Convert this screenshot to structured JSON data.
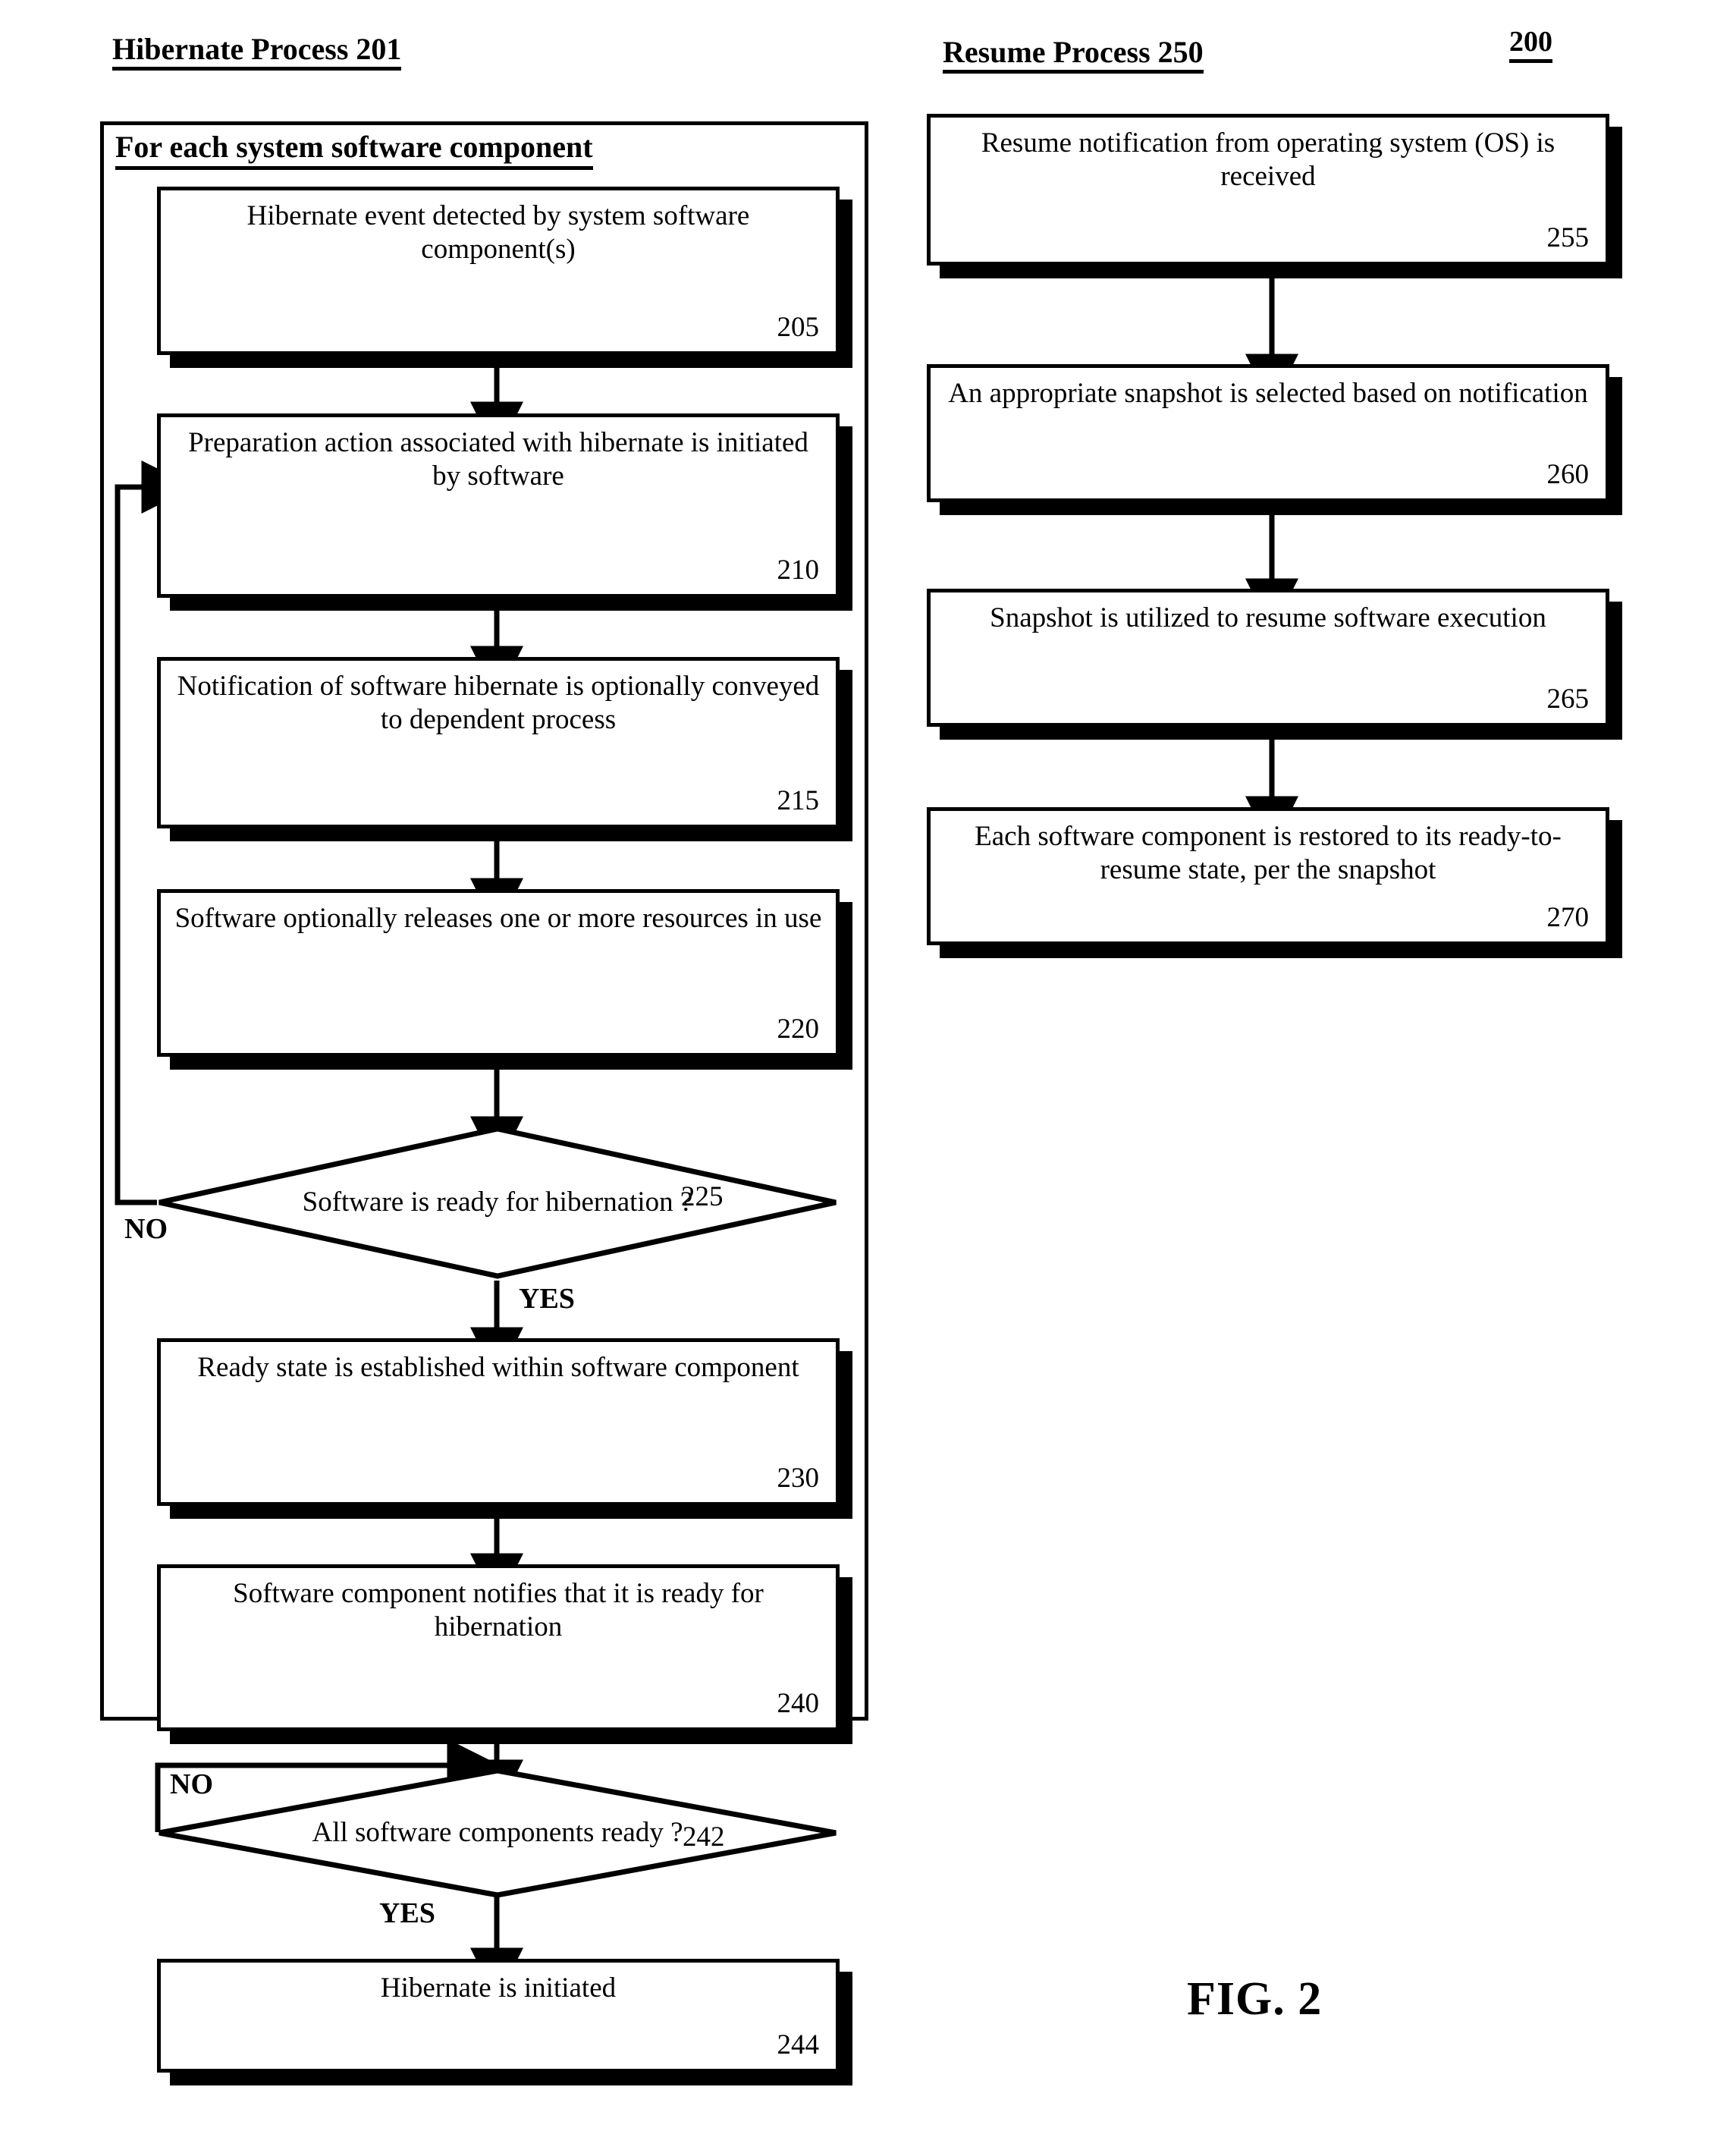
{
  "figure": {
    "caption": "FIG. 2",
    "figure_ref": "200"
  },
  "columns": {
    "left": {
      "heading": "Hibernate Process 201",
      "group_heading": "For each system software component"
    },
    "right": {
      "heading": "Resume Process 250"
    }
  },
  "hibernate_process": {
    "nodes": [
      {
        "id": "205",
        "type": "process",
        "text": "Hibernate event detected by system software component(s)",
        "ref": "205"
      },
      {
        "id": "210",
        "type": "process",
        "text": "Preparation action associated with hibernate is initiated by software",
        "ref": "210"
      },
      {
        "id": "215",
        "type": "process",
        "text": "Notification of software hibernate is optionally conveyed to dependent process",
        "ref": "215"
      },
      {
        "id": "220",
        "type": "process",
        "text": "Software optionally releases one or more resources in use",
        "ref": "220"
      },
      {
        "id": "225",
        "type": "decision",
        "text": "Software is ready for hibernation ?",
        "ref": "225"
      },
      {
        "id": "230",
        "type": "process",
        "text": "Ready state is established within software component",
        "ref": "230"
      },
      {
        "id": "240",
        "type": "process",
        "text": "Software component notifies that it is ready for hibernation",
        "ref": "240"
      },
      {
        "id": "242",
        "type": "decision",
        "text": "All software components ready ?",
        "ref": "242"
      },
      {
        "id": "244",
        "type": "process",
        "text": "Hibernate is initiated",
        "ref": "244"
      }
    ],
    "edge_labels": {
      "d225_no": "NO",
      "d225_yes": "YES",
      "d242_no": "NO",
      "d242_yes": "YES"
    }
  },
  "resume_process": {
    "nodes": [
      {
        "id": "255",
        "type": "process",
        "text": "Resume notification from operating system (OS) is received",
        "ref": "255"
      },
      {
        "id": "260",
        "type": "process",
        "text": "An appropriate snapshot is selected based on notification",
        "ref": "260"
      },
      {
        "id": "265",
        "type": "process",
        "text": "Snapshot is utilized to resume software execution",
        "ref": "265"
      },
      {
        "id": "270",
        "type": "process",
        "text": "Each software component is restored to its ready-to-resume state, per the snapshot",
        "ref": "270"
      }
    ]
  },
  "style": {
    "line_color": "#000000",
    "box_fill": "#ffffff",
    "shadow_color": "#000000"
  }
}
